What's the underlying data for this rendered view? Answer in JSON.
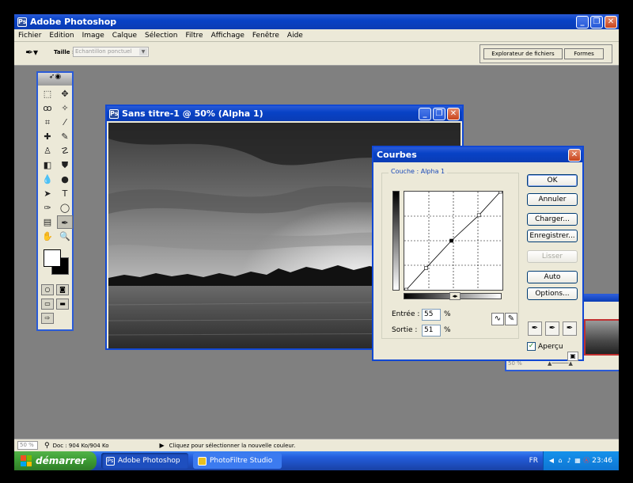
{
  "app": {
    "title": "Adobe Photoshop",
    "icon": "photoshop-app-icon"
  },
  "menu": [
    "Fichier",
    "Edition",
    "Image",
    "Calque",
    "Sélection",
    "Filtre",
    "Affichage",
    "Fenêtre",
    "Aide"
  ],
  "options_bar": {
    "tool_icon": "eyedropper-icon",
    "size_label": "Taille :",
    "size_value": "Echantillon ponctuel",
    "tabs": [
      "Explorateur de fichiers",
      "Formes"
    ]
  },
  "document": {
    "title": "Sans titre-1 @ 50% (Alpha 1)"
  },
  "curves": {
    "title": "Courbes",
    "channel_label": "Couche :",
    "channel_value": "Alpha 1",
    "input_label": "Entrée :",
    "input_value": "55",
    "output_label": "Sortie :",
    "output_value": "51",
    "percent": "%",
    "buttons": [
      "OK",
      "Annuler",
      "Charger...",
      "Enregistrer...",
      "Lisser",
      "Auto",
      "Options..."
    ],
    "disabled_button": "Lisser",
    "preview_label": "Aperçu",
    "preview_checked": true,
    "curve_points": [
      [
        2,
        0
      ],
      [
        22,
        22
      ],
      [
        48,
        50
      ],
      [
        76,
        76
      ],
      [
        98,
        100
      ]
    ]
  },
  "navigator": {
    "zoom": "50 %"
  },
  "status": {
    "zoom": "50 %",
    "doc": "Doc : 904 Ko/904 Ko",
    "message": "Cliquez pour sélectionner la nouvelle couleur."
  },
  "taskbar": {
    "start": "démarrer",
    "tasks": [
      "Adobe Photoshop",
      "PhotoFiltre Studio"
    ],
    "language": "FR",
    "clock": "23:46"
  },
  "colors": {
    "title_blue": "#0842c6",
    "start_green": "#3c9b33",
    "taskbar_blue": "#245edc",
    "desktop_gray": "#808080"
  }
}
